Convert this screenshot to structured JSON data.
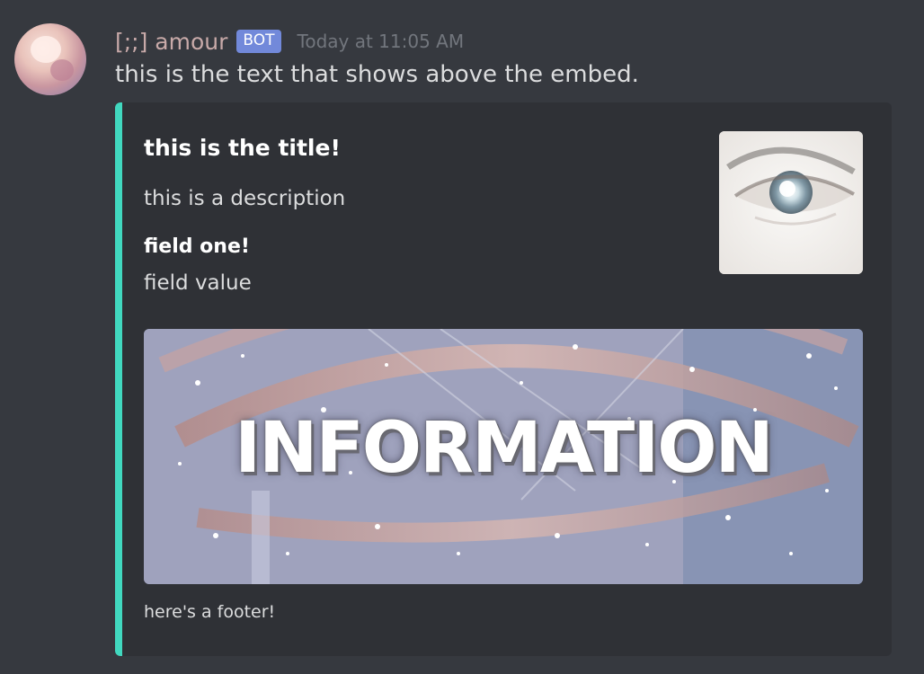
{
  "author": {
    "username": "[;;] amour",
    "bot_tag": "BOT",
    "timestamp": "Today at 11:05 AM"
  },
  "message": {
    "content": "this is the text that shows above the embed."
  },
  "embed": {
    "accent_color": "#41d8bf",
    "title": "this is the title!",
    "description": "this is a description",
    "fields": [
      {
        "name": "field one!",
        "value": "field value"
      }
    ],
    "thumbnail_icon": "eye-closeup-image",
    "image": {
      "icon": "information-banner-image",
      "text": "INFORMATION"
    },
    "footer": "here's a footer!"
  }
}
